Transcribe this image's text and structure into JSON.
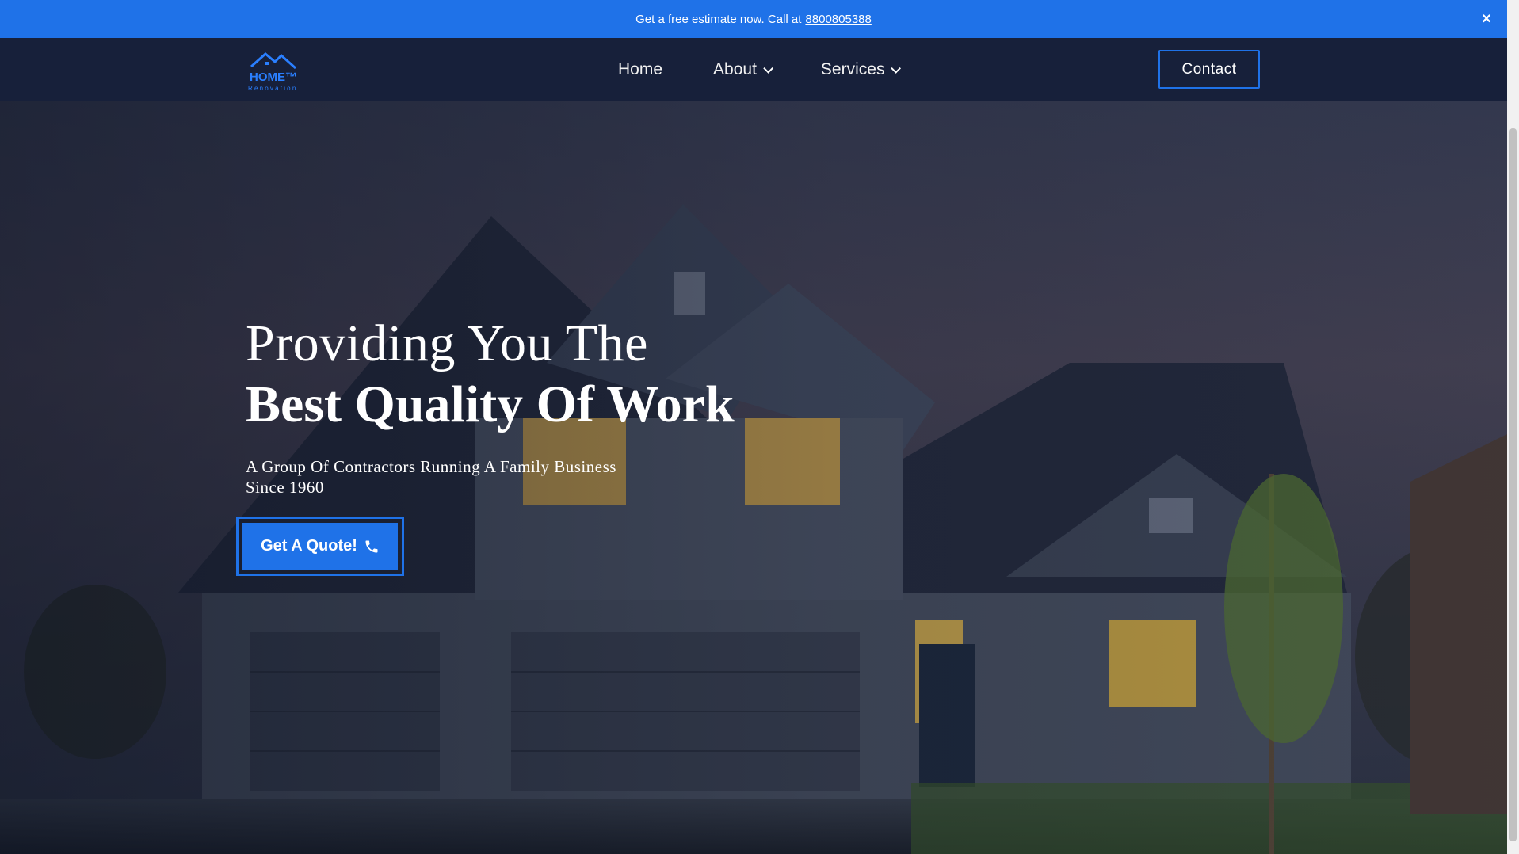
{
  "announcement": {
    "text": "Get a free estimate now. Call at",
    "phone": "8800805388",
    "close_icon": "close-icon"
  },
  "navbar": {
    "logo": {
      "word": "HOME™",
      "tagline": "Renovation"
    },
    "links": [
      {
        "label": "Home",
        "has_dropdown": false
      },
      {
        "label": "About",
        "has_dropdown": true
      },
      {
        "label": "Services",
        "has_dropdown": true
      }
    ],
    "contact_label": "Contact"
  },
  "hero": {
    "title_line1": "Providing You The",
    "title_line2": "Best Quality Of Work",
    "subtitle": "A Group Of Contractors Running A Family Business Since 1960",
    "cta_label": "Get A Quote!",
    "cta_icon": "phone-icon"
  },
  "colors": {
    "accent": "#1f72e8",
    "navbar_bg": "#17203a",
    "text_light": "#ffffff"
  }
}
